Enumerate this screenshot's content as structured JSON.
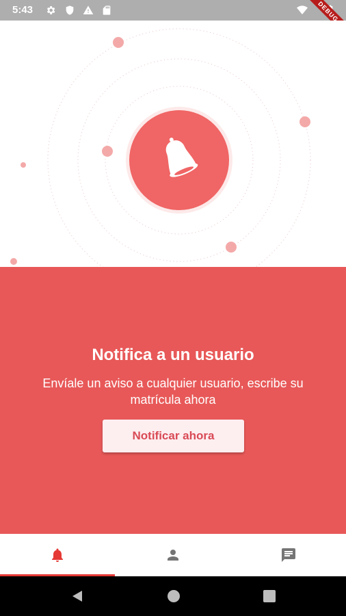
{
  "status_bar": {
    "time": "5:43",
    "icons": [
      "settings-icon",
      "shield-icon",
      "warning-icon",
      "sd-card-icon",
      "wifi-icon",
      "battery-icon"
    ],
    "debug_banner": "DEBUG"
  },
  "hero": {
    "icon": "bell-icon",
    "accent_color": "#f06565"
  },
  "panel": {
    "title": "Notifica a un usuario",
    "description": "Envíale un aviso a cualquier usuario, escribe su matrícula ahora",
    "button_label": "Notificar ahora",
    "background_color": "#e85858"
  },
  "bottom_nav": {
    "items": [
      {
        "icon": "bell-icon",
        "active": true
      },
      {
        "icon": "person-icon",
        "active": false
      },
      {
        "icon": "chat-icon",
        "active": false
      }
    ],
    "active_color": "#e53935",
    "inactive_color": "#757575"
  },
  "system_nav": {
    "buttons": [
      "back-icon",
      "home-icon",
      "recents-icon"
    ]
  }
}
